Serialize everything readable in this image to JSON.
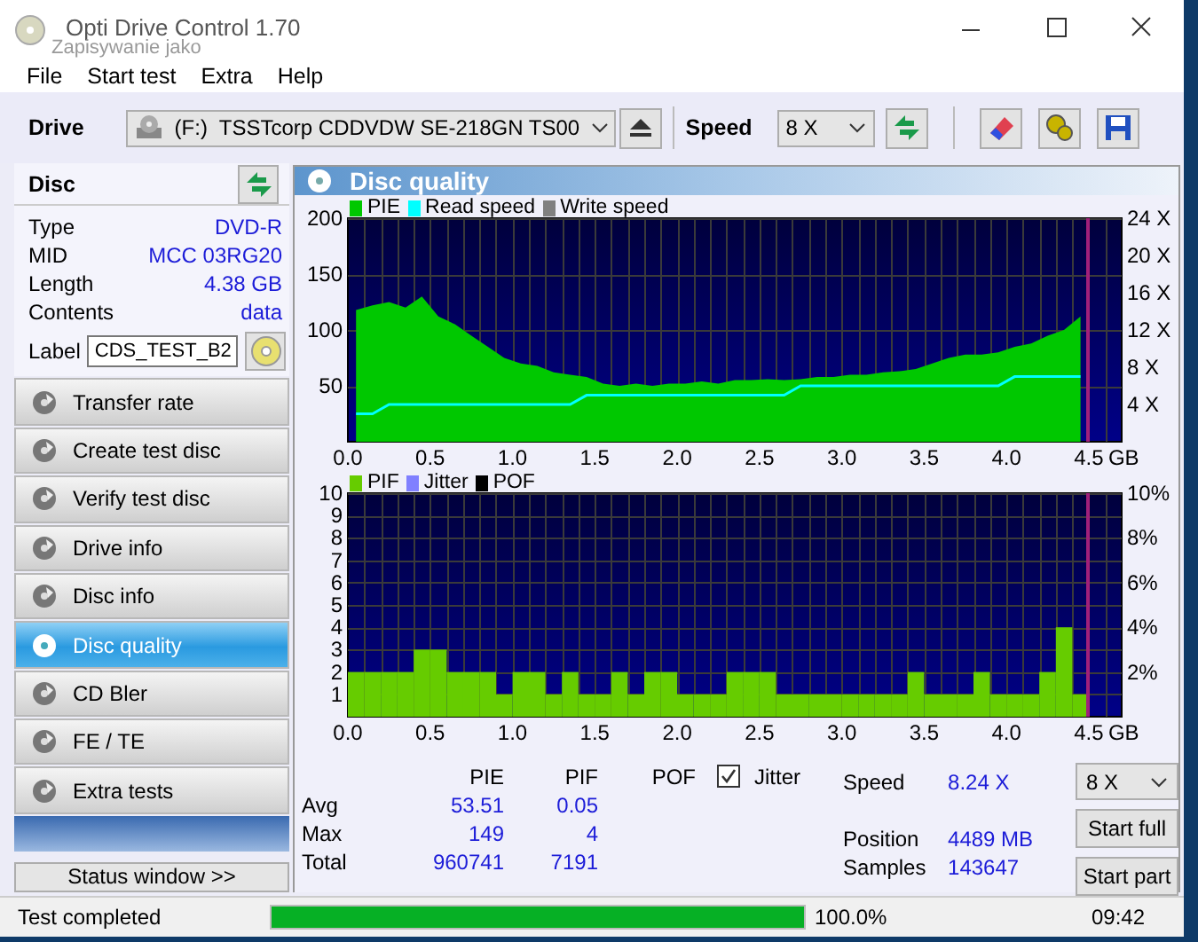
{
  "window": {
    "title": "Opti Drive Control 1.70",
    "overlay_text": "Zapisywanie jako"
  },
  "menu": [
    {
      "label": "File"
    },
    {
      "label": "Start test"
    },
    {
      "label": "Extra"
    },
    {
      "label": "Help"
    }
  ],
  "toolbar": {
    "drive_label": "Drive",
    "drive": "(F:)  TSSTcorp CDDVDW SE-218GN TS00",
    "speed_label": "Speed",
    "speed": "8 X"
  },
  "disc": {
    "title": "Disc",
    "fields": [
      {
        "label": "Type",
        "value": "DVD-R"
      },
      {
        "label": "MID",
        "value": "MCC 03RG20"
      },
      {
        "label": "Length",
        "value": "4.38 GB"
      },
      {
        "label": "Contents",
        "value": "data"
      }
    ],
    "label_field": {
      "label": "Label",
      "value": "CDS_TEST_B2"
    }
  },
  "nav": [
    {
      "label": "Transfer rate",
      "selected": false
    },
    {
      "label": "Create test disc",
      "selected": false
    },
    {
      "label": "Verify test disc",
      "selected": false
    },
    {
      "label": "Drive info",
      "selected": false
    },
    {
      "label": "Disc info",
      "selected": false
    },
    {
      "label": "Disc quality",
      "selected": true
    },
    {
      "label": "CD Bler",
      "selected": false
    },
    {
      "label": "FE / TE",
      "selected": false
    },
    {
      "label": "Extra tests",
      "selected": false
    }
  ],
  "status_window_button": "Status window >>",
  "panel": {
    "title": "Disc quality"
  },
  "pie_chart": {
    "legend_extra": [
      {
        "label": "Write speed",
        "color": "#808080"
      }
    ],
    "x_unit": "GB",
    "chart_data": {
      "type": "area",
      "grid": true,
      "x": [
        0.05,
        0.15,
        0.25,
        0.35,
        0.45,
        0.55,
        0.65,
        0.75,
        0.85,
        0.95,
        1.05,
        1.15,
        1.25,
        1.35,
        1.45,
        1.55,
        1.65,
        1.75,
        1.85,
        1.95,
        2.05,
        2.15,
        2.25,
        2.35,
        2.45,
        2.55,
        2.65,
        2.75,
        2.85,
        2.95,
        3.05,
        3.15,
        3.25,
        3.35,
        3.45,
        3.55,
        3.65,
        3.75,
        3.85,
        3.95,
        4.05,
        4.15,
        4.25,
        4.35,
        4.45
      ],
      "series": [
        {
          "name": "PIE",
          "color": "#00c800",
          "values": [
            118,
            122,
            125,
            120,
            130,
            112,
            105,
            95,
            85,
            75,
            70,
            68,
            62,
            60,
            58,
            52,
            50,
            52,
            50,
            52,
            52,
            54,
            52,
            55,
            55,
            56,
            55,
            56,
            58,
            58,
            60,
            60,
            62,
            63,
            65,
            70,
            75,
            78,
            78,
            80,
            85,
            88,
            95,
            100,
            112
          ]
        }
      ],
      "xlim": [
        0,
        4.7
      ],
      "ylim": [
        0,
        200
      ],
      "xticks": [
        {
          "value": 0,
          "label": "0.0"
        },
        {
          "value": 0.5,
          "label": "0.5"
        },
        {
          "value": 1,
          "label": "1.0"
        },
        {
          "value": 1.5,
          "label": "1.5"
        },
        {
          "value": 2,
          "label": "2.0"
        },
        {
          "value": 2.5,
          "label": "2.5"
        },
        {
          "value": 3,
          "label": "3.0"
        },
        {
          "value": 3.5,
          "label": "3.5"
        },
        {
          "value": 4,
          "label": "4.0"
        },
        {
          "value": 4.5,
          "label": "4.5"
        }
      ],
      "yticks": [
        50,
        100,
        150,
        200
      ]
    },
    "speed_chart": {
      "chart_data": {
        "type": "line",
        "x": [
          0.05,
          0.15,
          0.25,
          0.35,
          0.45,
          0.55,
          0.65,
          0.75,
          0.85,
          0.95,
          1.05,
          1.15,
          1.25,
          1.35,
          1.45,
          1.55,
          1.65,
          1.75,
          1.85,
          1.95,
          2.05,
          2.15,
          2.25,
          2.35,
          2.45,
          2.55,
          2.65,
          2.75,
          2.85,
          2.95,
          3.05,
          3.15,
          3.25,
          3.35,
          3.45,
          3.55,
          3.65,
          3.75,
          3.85,
          3.95,
          4.05,
          4.15,
          4.25,
          4.35,
          4.45
        ],
        "series": [
          {
            "name": "Read speed",
            "color": "#00ffff",
            "values": [
              3,
              3,
              4,
              4,
              4,
              4,
              4,
              4,
              4,
              4,
              4,
              4,
              4,
              4,
              5,
              5,
              5,
              5,
              5,
              5,
              5,
              5,
              5,
              5,
              5,
              5,
              5,
              6,
              6,
              6,
              6,
              6,
              6,
              6,
              6,
              6,
              6,
              6,
              6,
              6,
              7,
              7,
              7,
              7,
              7
            ]
          }
        ],
        "xlim": [
          0,
          4.7
        ],
        "ylim": [
          0,
          24
        ],
        "yticks": [
          {
            "value": 24,
            "label": "24 X"
          },
          {
            "value": 20,
            "label": "20 X"
          },
          {
            "value": 16,
            "label": "16 X"
          },
          {
            "value": 12,
            "label": "12 X"
          },
          {
            "value": 8,
            "label": "8 X"
          },
          {
            "value": 4,
            "label": "4 X"
          }
        ]
      }
    }
  },
  "pif_chart": {
    "legend_extra": [
      {
        "label": "Jitter",
        "color": "#8080ff"
      },
      {
        "label": "POF",
        "color": "#000000"
      }
    ],
    "right_ticks": [
      "10%",
      "8%",
      "6%",
      "4%",
      "2%"
    ],
    "x_unit": "GB",
    "chart_data": {
      "type": "bar",
      "grid": true,
      "x": [
        0.05,
        0.15,
        0.25,
        0.35,
        0.45,
        0.55,
        0.65,
        0.75,
        0.85,
        0.95,
        1.05,
        1.15,
        1.25,
        1.35,
        1.45,
        1.55,
        1.65,
        1.75,
        1.85,
        1.95,
        2.05,
        2.15,
        2.25,
        2.35,
        2.45,
        2.55,
        2.65,
        2.75,
        2.85,
        2.95,
        3.05,
        3.15,
        3.25,
        3.35,
        3.45,
        3.55,
        3.65,
        3.75,
        3.85,
        3.95,
        4.05,
        4.15,
        4.25,
        4.35,
        4.45
      ],
      "series": [
        {
          "name": "PIF",
          "color": "#66cc00",
          "values": [
            2,
            2,
            2,
            2,
            3,
            3,
            2,
            2,
            2,
            1,
            2,
            2,
            1,
            2,
            1,
            1,
            2,
            1,
            2,
            2,
            1,
            1,
            1,
            2,
            2,
            2,
            1,
            1,
            1,
            1,
            1,
            1,
            1,
            1,
            2,
            1,
            1,
            1,
            2,
            1,
            1,
            1,
            2,
            4,
            1
          ]
        }
      ],
      "xlim": [
        0,
        4.7
      ],
      "ylim": [
        0,
        10
      ],
      "xticks": [
        {
          "value": 0,
          "label": "0.0"
        },
        {
          "value": 0.5,
          "label": "0.5"
        },
        {
          "value": 1,
          "label": "1.0"
        },
        {
          "value": 1.5,
          "label": "1.5"
        },
        {
          "value": 2,
          "label": "2.0"
        },
        {
          "value": 2.5,
          "label": "2.5"
        },
        {
          "value": 3,
          "label": "3.0"
        },
        {
          "value": 3.5,
          "label": "3.5"
        },
        {
          "value": 4,
          "label": "4.0"
        },
        {
          "value": 4.5,
          "label": "4.5"
        }
      ],
      "yticks": [
        1,
        2,
        3,
        4,
        5,
        6,
        7,
        8,
        9,
        10
      ]
    }
  },
  "stats": {
    "columns": [
      "PIE",
      "PIF",
      "POF"
    ],
    "jitter": {
      "label": "Jitter",
      "checked": true
    },
    "rows": [
      {
        "label": "Avg",
        "values": [
          "53.51",
          "0.05"
        ]
      },
      {
        "label": "Max",
        "values": [
          "149",
          "4"
        ]
      },
      {
        "label": "Total",
        "values": [
          "960741",
          "7191"
        ]
      }
    ]
  },
  "info": [
    {
      "label": "Speed",
      "value": "8.24 X"
    },
    {
      "label": "Position",
      "value": "4489 MB"
    },
    {
      "label": "Samples",
      "value": "143647"
    }
  ],
  "controls": {
    "speed": "8 X",
    "buttons": [
      "Start full",
      "Start part"
    ]
  },
  "status_bar": {
    "text": "Test completed",
    "level": 1,
    "percent": "100.0%",
    "time": "09:42"
  }
}
